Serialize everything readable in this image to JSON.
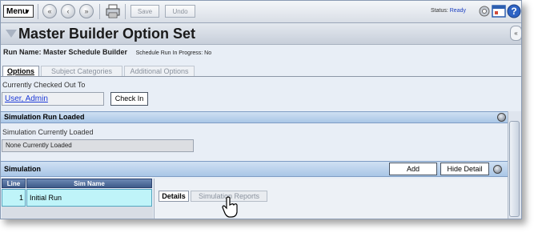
{
  "toolbar": {
    "menu_label": "Menu",
    "save_label": "Save",
    "undo_label": "Undo",
    "status_label": "Status:",
    "status_value": "Ready",
    "status_color": "#1d40c0"
  },
  "header": {
    "title": "Master Builder Option Set"
  },
  "run": {
    "label": "Run Name:",
    "name": "Master Schedule Builder",
    "progress_text": "Schedule Run In Progress: No"
  },
  "tabs": [
    {
      "label": "Options",
      "active": true
    },
    {
      "label": "Subject Categories",
      "active": false
    },
    {
      "label": "Additional Options",
      "active": false
    }
  ],
  "checkout": {
    "label": "Currently Checked Out To",
    "user": "User, Admin",
    "check_in_label": "Check In"
  },
  "simulation_run": {
    "header": "Simulation Run Loaded",
    "label": "Simulation Currently Loaded",
    "value": "None Currently Loaded"
  },
  "simulation": {
    "header": "Simulation",
    "add_label": "Add",
    "hide_detail_label": "Hide Detail",
    "columns": [
      "Line",
      "Sim Name"
    ],
    "rows": [
      {
        "line": "1",
        "sim_name": "Initial Run"
      }
    ],
    "detail_tabs": [
      {
        "label": "Details",
        "active": true
      },
      {
        "label": "Simulation Reports",
        "active": false
      }
    ]
  },
  "colors": {
    "link": "#1c3ad8",
    "section_header": "#a9c6e6",
    "selected_row": "#bff4f9"
  }
}
